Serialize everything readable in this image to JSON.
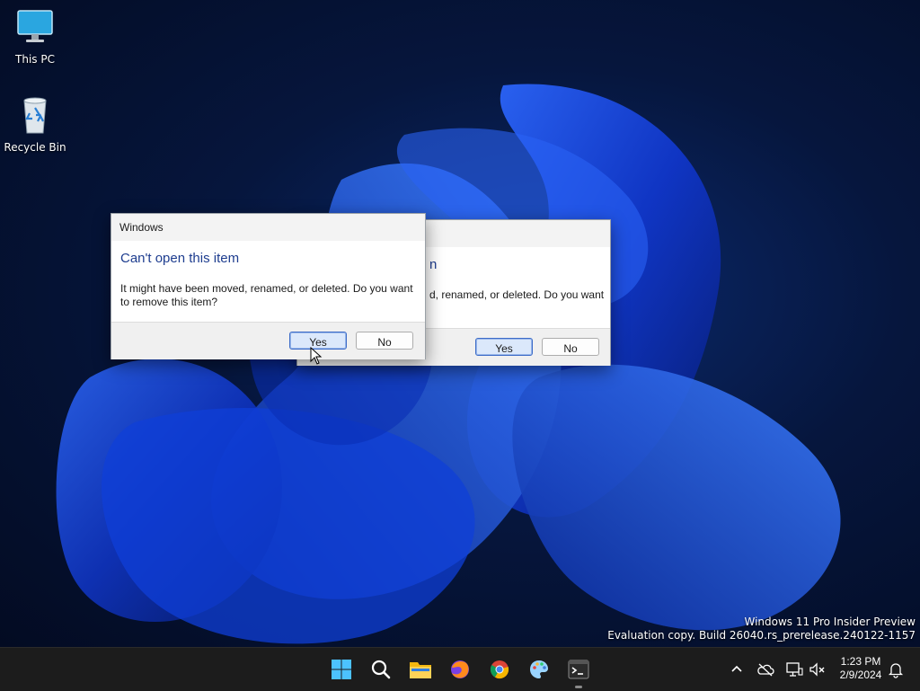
{
  "desktop": {
    "icons": [
      {
        "label": "This PC",
        "icon": "monitor-icon"
      },
      {
        "label": "Recycle Bin",
        "icon": "recycle-bin-icon"
      }
    ],
    "watermark": {
      "line1": "Windows 11 Pro Insider Preview",
      "line2": "Evaluation copy. Build 26040.rs_prerelease.240122-1157"
    }
  },
  "dialog_front": {
    "title": "Windows",
    "heading": "Can't open this item",
    "message": "It might have been moved, renamed, or deleted. Do you want to remove this item?",
    "yes_label": "Yes",
    "no_label": "No"
  },
  "dialog_back": {
    "heading_visible": "n",
    "message_visible": "d, renamed, or deleted. Do you want",
    "yes_label": "Yes",
    "no_label": "No"
  },
  "taskbar": {
    "apps": [
      "start-icon",
      "search-icon",
      "file-explorer-icon",
      "firefox-icon",
      "chrome-icon",
      "paint-icon",
      "terminal-icon"
    ],
    "tray": [
      "chevron-up-icon",
      "onedrive-icon",
      "network-icon",
      "volume-muted-icon"
    ],
    "clock_time": "1:23 PM",
    "clock_date": "2/9/2024"
  },
  "colors": {
    "accent": "#1e3d8f",
    "button_default": "#dbe8fb",
    "taskbar": "#1c1c1c"
  }
}
